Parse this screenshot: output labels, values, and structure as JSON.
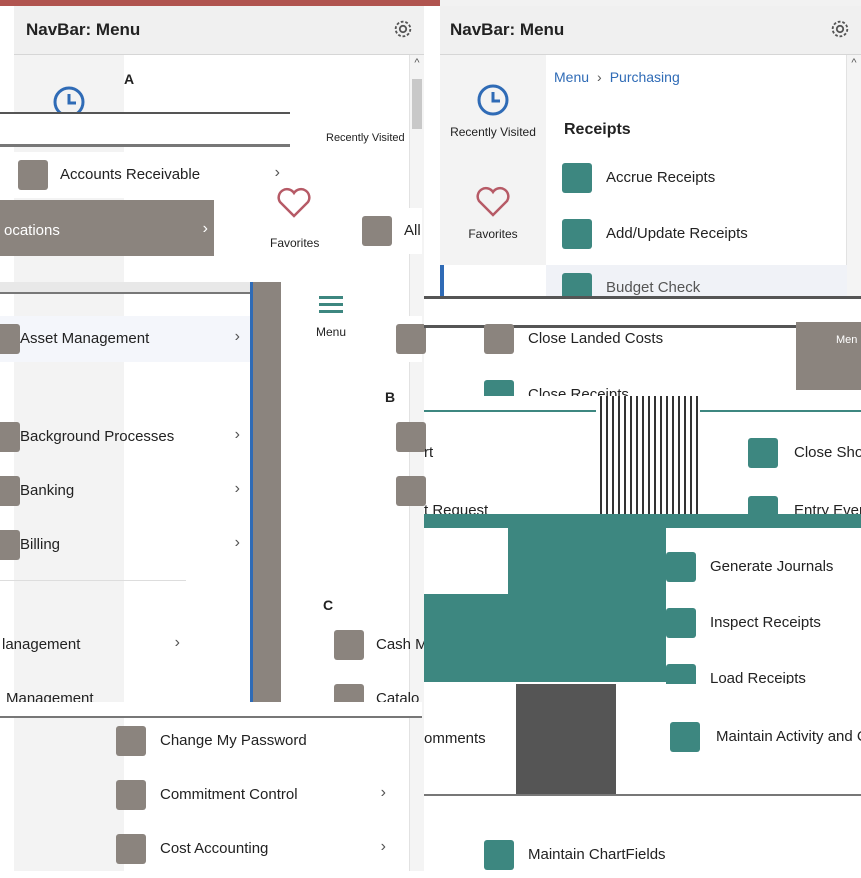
{
  "colors": {
    "accent_blue": "#2f6bb6",
    "teal": "#3d8780",
    "folder_gray": "#8b847e",
    "heart": "#b65a66"
  },
  "left": {
    "navbar_title": "NavBar: Menu",
    "rail": {
      "recently_visited": "Recently Visited",
      "favorites": "Favorites",
      "menu": "Menu"
    },
    "letters": {
      "a": "A",
      "b": "B",
      "c": "C"
    },
    "rows": {
      "accounts_receivable": "Accounts Receivable",
      "allocations": "ocations",
      "asset_management": "Asset Management",
      "background_processes": "Background Processes",
      "banking": "Banking",
      "billing": "Billing",
      "management": "lanagement",
      "management2": "Management",
      "change_password": "Change My Password",
      "commitment_control": "Commitment Control",
      "cost_accounting": "Cost Accounting",
      "cash_m": "Cash M",
      "catalog": "Catalo",
      "all": "All"
    }
  },
  "right": {
    "navbar_title": "NavBar: Menu",
    "rail": {
      "recently_visited": "Recently Visited",
      "favorites": "Favorites",
      "menu": "Men"
    },
    "breadcrumb": {
      "root": "Menu",
      "current": "Purchasing"
    },
    "page_title": "Receipts",
    "items": {
      "accrue": "Accrue Receipts",
      "add_update": "Add/Update Receipts",
      "budget_check": "Budget Check",
      "close_landed": "Close Landed Costs",
      "close_receipts": "Close Receipts",
      "close_short": "Close Sho",
      "entry_event": "Entry Ever",
      "generate_journals": "Generate Journals",
      "inspect": "Inspect Receipts",
      "load": "Load Receipts",
      "maintain_activity": "Maintain Activity and C",
      "maintain_chartfields": "Maintain ChartFields",
      "comments": "omments",
      "request": "t Request",
      "rt": "rt"
    }
  }
}
